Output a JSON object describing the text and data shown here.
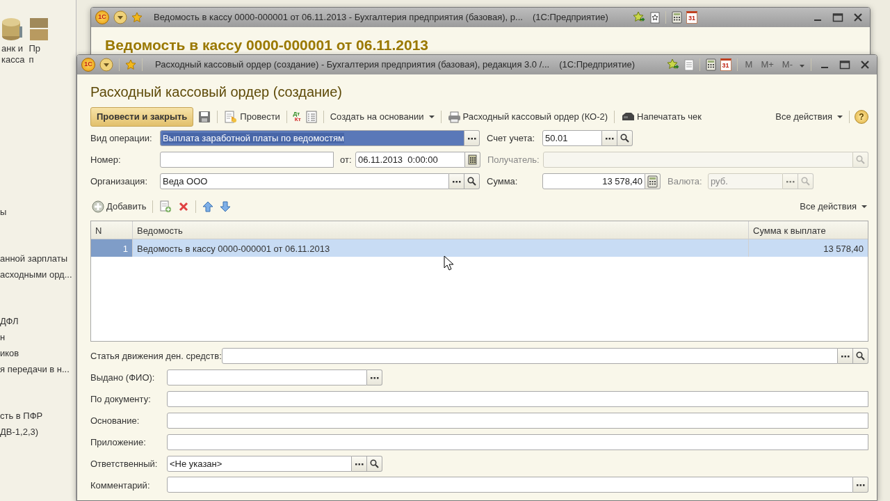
{
  "desktop": {
    "launchers": [
      {
        "kind": "coins",
        "lines": [
          "анк и",
          "касса"
        ]
      },
      {
        "kind": "boxes",
        "lines": [
          "Пр",
          "п"
        ]
      }
    ],
    "nav_groups": [
      [
        "ы"
      ],
      [
        "анной зарплаты",
        "асходными орд..."
      ],
      [
        "ДФЛ",
        "н",
        "иков",
        "я передачи в н..."
      ],
      [
        "сть в ПФР",
        "ДВ-1,2,3)"
      ]
    ]
  },
  "back_window": {
    "logo": "1С",
    "title": "Ведомость в кассу 0000-000001 от 06.11.2013 - Бухгалтерия предприятия (базовая), р...",
    "app": "(1С:Предприятие)",
    "calendar_day": "31",
    "heading": "Ведомость в кассу 0000-000001 от 06.11.2013"
  },
  "window": {
    "logo": "1С",
    "title": "Расходный кассовый ордер (создание) - Бухгалтерия предприятия (базовая), редакция 3.0 /...",
    "app": "(1С:Предприятие)",
    "calendar_day": "31",
    "memory_buttons": [
      "M",
      "M+",
      "M-"
    ],
    "heading": "Расходный кассовый ордер (создание)",
    "toolbar": [
      {
        "kind": "primary",
        "label": "Провести и закрыть"
      },
      {
        "kind": "save"
      },
      {
        "kind": "post",
        "label": "Провести"
      },
      {
        "kind": "dtkt",
        "debit": "Дт",
        "credit": "Кт"
      },
      {
        "kind": "report"
      },
      {
        "kind": "create_based",
        "label": "Создать на основании"
      },
      {
        "kind": "print",
        "label": "Расходный кассовый ордер (КО-2)"
      },
      {
        "kind": "receipt",
        "label": "Напечатать чек"
      }
    ],
    "all_actions": "Все действия",
    "help": "?",
    "fields": {
      "operation": {
        "label": "Вид операции:",
        "value": "Выплата заработной платы по ведомостям",
        "selected": true,
        "disabled": false
      },
      "account": {
        "label": "Счет учета:",
        "value": "50.01",
        "disabled": false
      },
      "number": {
        "label": "Номер:",
        "disabled": false
      },
      "date": {
        "label": "от:",
        "value": "06.11.2013  0:00:00",
        "disabled": false
      },
      "recipient": {
        "label": "Получатель:",
        "disabled": true
      },
      "organization": {
        "label": "Организация:",
        "value": "Веда ООО",
        "disabled": false
      },
      "amount": {
        "label": "Сумма:",
        "value": "13 578,40",
        "disabled": false
      },
      "currency": {
        "label": "Валюта:",
        "value": "руб.",
        "disabled": true
      }
    },
    "table_toolbar": [
      {
        "kind": "add",
        "label": "Добавить"
      },
      {
        "kind": "copy"
      },
      {
        "kind": "delete"
      },
      {
        "kind": "up"
      },
      {
        "kind": "down"
      }
    ],
    "table_all_actions": "Все действия",
    "table": {
      "columns": [
        "N",
        "Ведомость",
        "Сумма к выплате"
      ],
      "rows": [
        {
          "cells": [
            "1",
            "Ведомость в кассу 0000-000001 от 06.11.2013",
            "13 578,40"
          ],
          "selected": true
        }
      ]
    },
    "details": [
      {
        "kind": "catalog",
        "label": "Статья движения ден. средств:"
      },
      {
        "kind": "person",
        "label": "Выдано (ФИО):"
      },
      {
        "kind": "text",
        "label": "По документу:"
      },
      {
        "kind": "text",
        "label": "Основание:"
      },
      {
        "kind": "text",
        "label": "Приложение:"
      },
      {
        "kind": "reference",
        "label": "Ответственный:",
        "value": "<Не указан>"
      },
      {
        "kind": "memo",
        "label": "Комментарий:"
      }
    ]
  }
}
